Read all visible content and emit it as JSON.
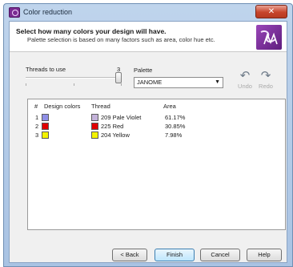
{
  "window": {
    "title": "Color reduction",
    "close_glyph": "✕"
  },
  "header": {
    "title": "Select how many colors your design will have.",
    "subtitle": "Palette selection is based on many factors such as area, color hue etc.",
    "logo_icon": "wilcom-logo"
  },
  "threads": {
    "label": "Threads to use",
    "value": "3",
    "slider_fraction": 1.0
  },
  "palette": {
    "label": "Palette",
    "selected": "JANOME"
  },
  "toolbar": {
    "undo_label": "Undo",
    "undo_icon": "undo-icon",
    "redo_label": "Redo",
    "redo_icon": "redo-icon"
  },
  "table": {
    "headers": [
      "#",
      "Design colors",
      "Thread",
      "Area"
    ],
    "rows": [
      {
        "num": "1",
        "design_color": "#8f8fe6",
        "thread_color": "#c4b3da",
        "thread": "209 Pale Violet",
        "area": "61.17%"
      },
      {
        "num": "2",
        "design_color": "#e00000",
        "thread_color": "#e00000",
        "thread": "225 Red",
        "area": "30.85%"
      },
      {
        "num": "3",
        "design_color": "#f3f300",
        "thread_color": "#f3f300",
        "thread": "204 Yellow",
        "area": "7.98%"
      }
    ]
  },
  "buttons": {
    "back": "< Back",
    "finish": "Finish",
    "cancel": "Cancel",
    "help": "Help"
  },
  "colors": {
    "title_bar": "#bfd4ec",
    "close_button": "#c7442b",
    "dialog_bg": "#f0f0f0",
    "logo": "#7a2a92"
  }
}
